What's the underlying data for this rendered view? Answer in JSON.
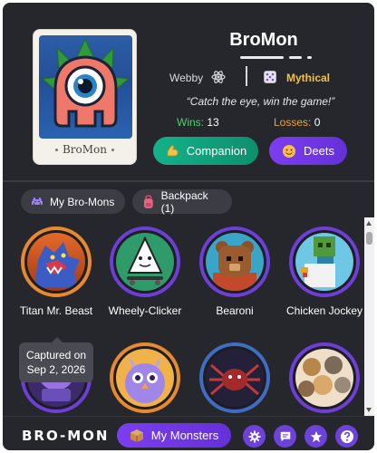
{
  "monster": {
    "name": "BroMon",
    "card_name": "BroMon",
    "creator": "Webby",
    "rarity": "Mythical",
    "tagline": "“Catch the eye, win the game!”",
    "wins_label": "Wins:",
    "wins": "13",
    "losses_label": "Losses:",
    "losses": "0"
  },
  "actions": {
    "companion_label": "Companion",
    "deets_label": "Deets"
  },
  "tabs": [
    {
      "label": "My Bro-Mons",
      "icon": "space-invader-icon"
    },
    {
      "label": "Backpack (1)",
      "icon": "backpack-icon"
    }
  ],
  "collection": [
    {
      "name": "Titan Mr. Beast",
      "icon": "werewolf-icon"
    },
    {
      "name": "Wheely-Clicker",
      "icon": "skater-cursor-icon"
    },
    {
      "name": "Bearoni",
      "icon": "bear-icon"
    },
    {
      "name": "Chicken Jockey",
      "icon": "zombie-chicken-icon"
    },
    {
      "name": "",
      "icon": "crystal-ball-icon"
    },
    {
      "name": "",
      "icon": "owl-icon"
    },
    {
      "name": "",
      "icon": "spider-icon"
    },
    {
      "name": "",
      "icon": "cats-icon"
    }
  ],
  "tooltip": {
    "line1": "Captured on",
    "line2": "Sep 2, 2026"
  },
  "footer": {
    "logo": "BRO-MON",
    "my_monsters_label": "My Monsters",
    "icons": [
      "gear-icon",
      "chat-icon",
      "star-icon",
      "help-icon"
    ]
  },
  "colors": {
    "background": "#26272c",
    "accent_purple": "#6c42d8",
    "accent_green": "#13b28a",
    "win_green": "#4ed06a",
    "loss_orange": "#f0a23a",
    "mythical_gold": "#f2c14c"
  }
}
